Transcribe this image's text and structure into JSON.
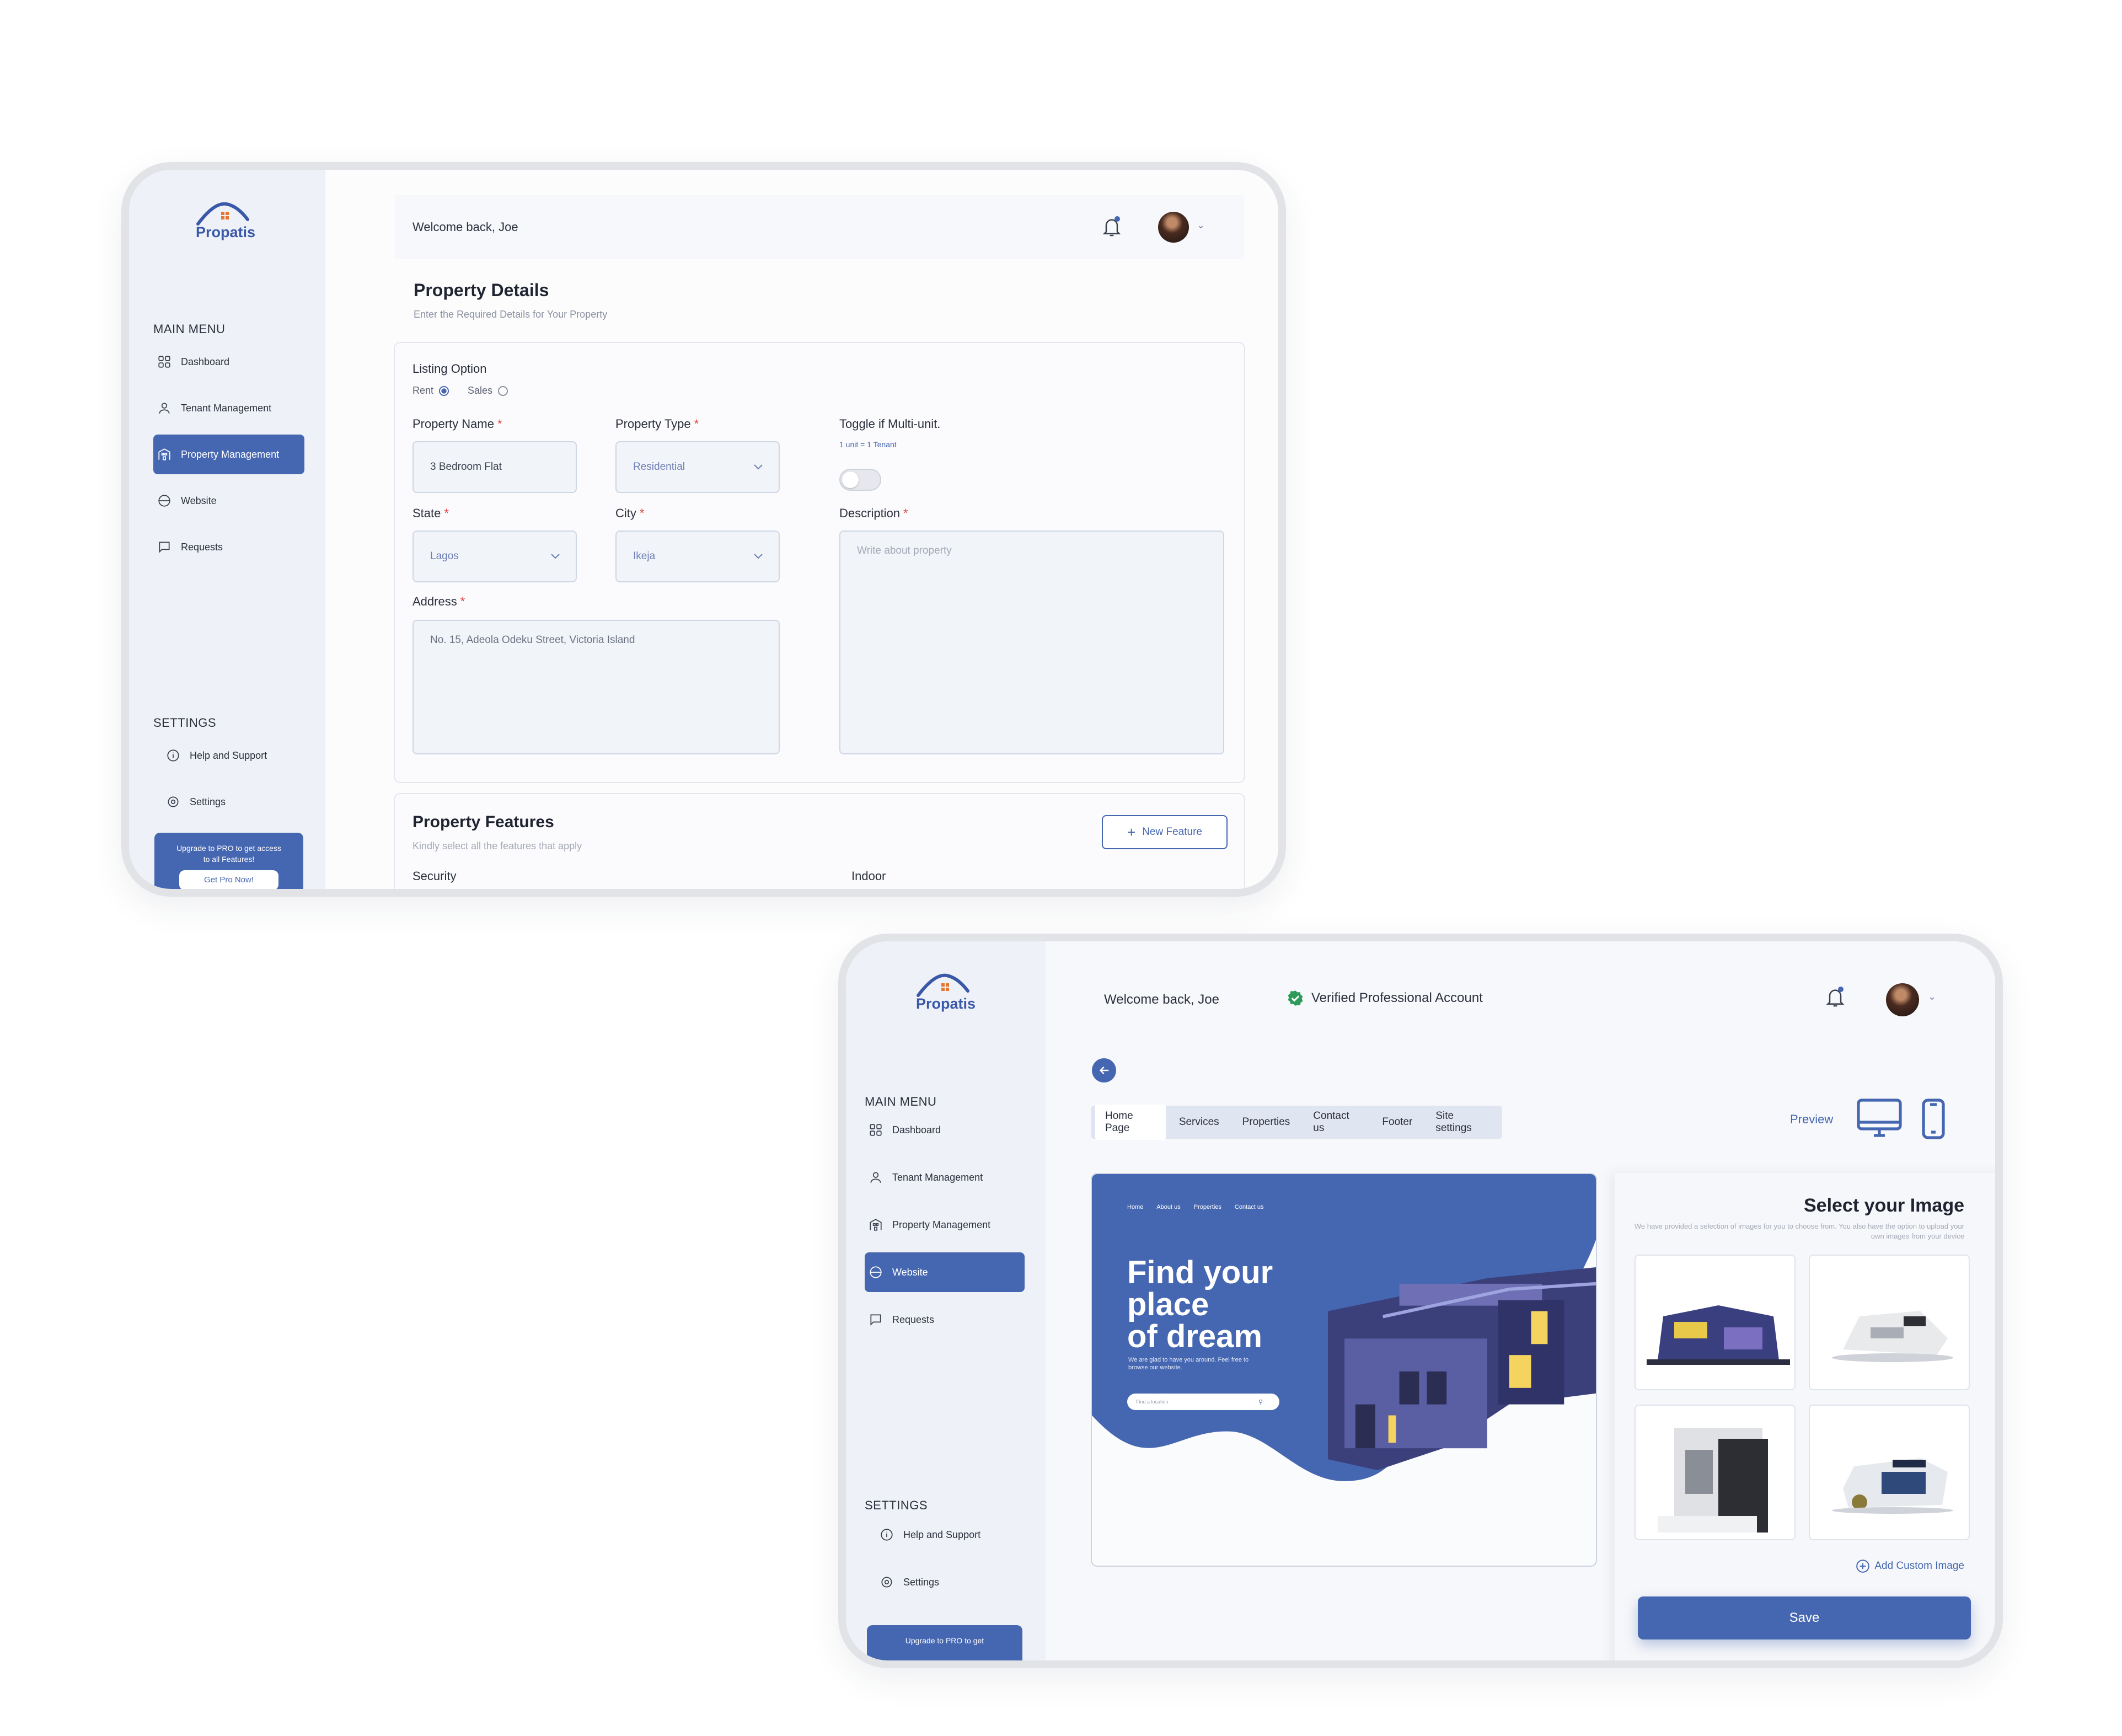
{
  "brand": {
    "name": "Propatis",
    "accent": "#4566b0"
  },
  "screen1": {
    "sidebar": {
      "main_menu_heading": "MAIN MENU",
      "items": [
        {
          "label": "Dashboard",
          "icon": "grid-icon"
        },
        {
          "label": "Tenant Management",
          "icon": "user-icon"
        },
        {
          "label": "Property Management",
          "icon": "building-icon",
          "active": true
        },
        {
          "label": "Website",
          "icon": "globe-icon"
        },
        {
          "label": "Requests",
          "icon": "chat-icon"
        }
      ],
      "settings_heading": "SETTINGS",
      "settings_items": [
        {
          "label": "Help and Support",
          "icon": "info-icon"
        },
        {
          "label": "Settings",
          "icon": "gear-icon"
        }
      ],
      "promo": {
        "text": "Upgrade to PRO to get access to all Features!",
        "button": "Get Pro Now!"
      }
    },
    "header": {
      "welcome": "Welcome back, Joe"
    },
    "title": "Property Details",
    "subtitle": "Enter the Required Details for Your Property",
    "form": {
      "listing_option_label": "Listing Option",
      "rent_label": "Rent",
      "sales_label": "Sales",
      "selected_listing": "Rent",
      "property_name_label": "Property Name",
      "property_name_value": "3 Bedroom Flat",
      "property_type_label": "Property Type",
      "property_type_value": "Residential",
      "toggle_label": "Toggle if Multi-unit.",
      "toggle_hint": "1 unit = 1 Tenant",
      "state_label": "State",
      "state_value": "Lagos",
      "city_label": "City",
      "city_value": "Ikeja",
      "description_label": "Description",
      "description_placeholder": "Write about property",
      "address_label": "Address",
      "address_placeholder": "No. 15, Adeola Odeku Street, Victoria Island"
    },
    "features": {
      "title": "Property Features",
      "subtitle": "Kindly select all the features that apply",
      "new_feature_button": "New Feature",
      "col1": "Security",
      "col2": "Indoor"
    }
  },
  "screen2": {
    "sidebar": {
      "main_menu_heading": "MAIN MENU",
      "items": [
        {
          "label": "Dashboard",
          "icon": "grid-icon"
        },
        {
          "label": "Tenant Management",
          "icon": "user-icon"
        },
        {
          "label": "Property Management",
          "icon": "building-icon"
        },
        {
          "label": "Website",
          "icon": "globe-icon",
          "active": true
        },
        {
          "label": "Requests",
          "icon": "chat-icon"
        }
      ],
      "settings_heading": "SETTINGS",
      "settings_items": [
        {
          "label": "Help and Support",
          "icon": "info-icon"
        },
        {
          "label": "Settings",
          "icon": "gear-icon"
        }
      ],
      "promo": {
        "text": "Upgrade to PRO to get"
      }
    },
    "header": {
      "welcome": "Welcome back, Joe",
      "verified": "Verified Professional Account"
    },
    "tabs": [
      {
        "label": "Home Page",
        "active": true
      },
      {
        "label": "Services"
      },
      {
        "label": "Properties"
      },
      {
        "label": "Contact us"
      },
      {
        "label": "Footer"
      },
      {
        "label": "Site settings"
      }
    ],
    "preview_label": "Preview",
    "hero": {
      "nav": [
        "Home",
        "About us",
        "Properties",
        "Contact us"
      ],
      "title_lines": [
        "Find your",
        "place",
        "of dream"
      ],
      "desc": "We are glad to have you around. Feel free to browse our website.",
      "search_placeholder": "Find a location"
    },
    "image_panel": {
      "title": "Select your Image",
      "subtitle": "We have provided a selection of images for you to choose from. You also have the option to upload your own images from your device",
      "add_custom": "Add Custom Image",
      "save_button": "Save"
    }
  }
}
